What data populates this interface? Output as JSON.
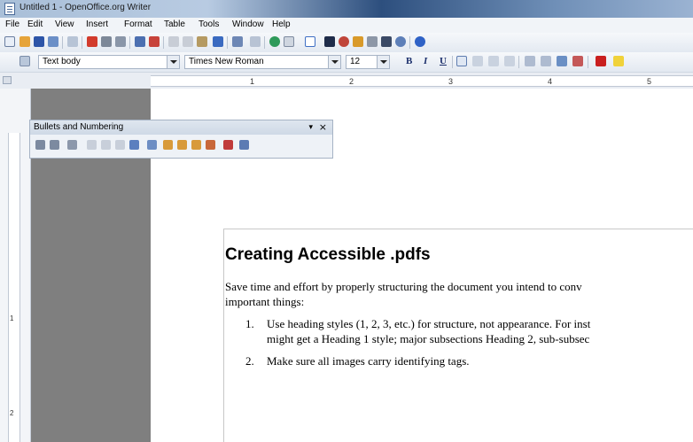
{
  "window": {
    "title": "Untitled 1 - OpenOffice.org Writer"
  },
  "menu": [
    "File",
    "Edit",
    "View",
    "Insert",
    "Format",
    "Table",
    "Tools",
    "Window",
    "Help"
  ],
  "formatting": {
    "paragraph_style": "Text body",
    "font_name": "Times New Roman",
    "font_size": "12",
    "bold": "B",
    "italic": "I",
    "underline": "U"
  },
  "ruler": {
    "numbers": [
      "1",
      "2",
      "3",
      "4",
      "5"
    ]
  },
  "vertical_ruler": {
    "numbers": [
      "1",
      "2"
    ]
  },
  "floating_toolbar": {
    "title": "Bullets and Numbering",
    "menu_glyph": "▾",
    "close_glyph": "×"
  },
  "document": {
    "heading": "Creating Accessible .pdfs",
    "paragraph_line1": "Save time and effort by properly structuring the document you intend to conv",
    "paragraph_line2": "important things:",
    "item1_num": "1.",
    "item1_line1": "Use heading styles (1, 2, 3, etc.) for structure, not appearance. For inst",
    "item1_line2": "might get a Heading 1 style; major subsections Heading 2, sub-subsec",
    "item2_num": "2.",
    "item2_line1": "Make sure all images carry identifying tags."
  },
  "icons": {
    "toolbar1": [
      "new-document-icon",
      "open-icon",
      "save-icon",
      "email-icon",
      "edit-file-icon",
      "export-pdf-icon",
      "print-icon",
      "page-preview-icon",
      "spellcheck-icon",
      "autospell-icon",
      "cut-icon",
      "copy-icon",
      "paste-icon",
      "format-paintbrush-icon",
      "undo-icon",
      "redo-icon",
      "hyperlink-icon",
      "table-icon",
      "show-draw-functions-icon",
      "find-replace-icon",
      "navigator-icon",
      "gallery-icon",
      "data-sources-icon",
      "nonprinting-chars-icon",
      "zoom-icon",
      "help-icon"
    ],
    "toolbar2": [
      "styles-formatting-icon",
      "align-left-icon",
      "align-center-icon",
      "align-right-icon",
      "justify-icon",
      "numbering-icon",
      "bullets-icon",
      "decrease-indent-icon",
      "increase-indent-icon",
      "font-color-icon",
      "highlight-icon"
    ],
    "floating": [
      "bullets-off-icon",
      "numbering-off-icon",
      "list-off-icon",
      "demote-icon",
      "promote-icon",
      "demote-subpoints-icon",
      "promote-subpoints-icon",
      "insert-unnumbered-entry-icon",
      "move-up-icon",
      "move-down-icon",
      "move-up-subpoints-icon",
      "move-down-subpoints-icon",
      "restart-numbering-icon",
      "bullets-numbering-dialog-icon"
    ]
  },
  "colors": {
    "workspace": "#7f7f7f",
    "toolbar_accent": "#1b2f6b"
  }
}
